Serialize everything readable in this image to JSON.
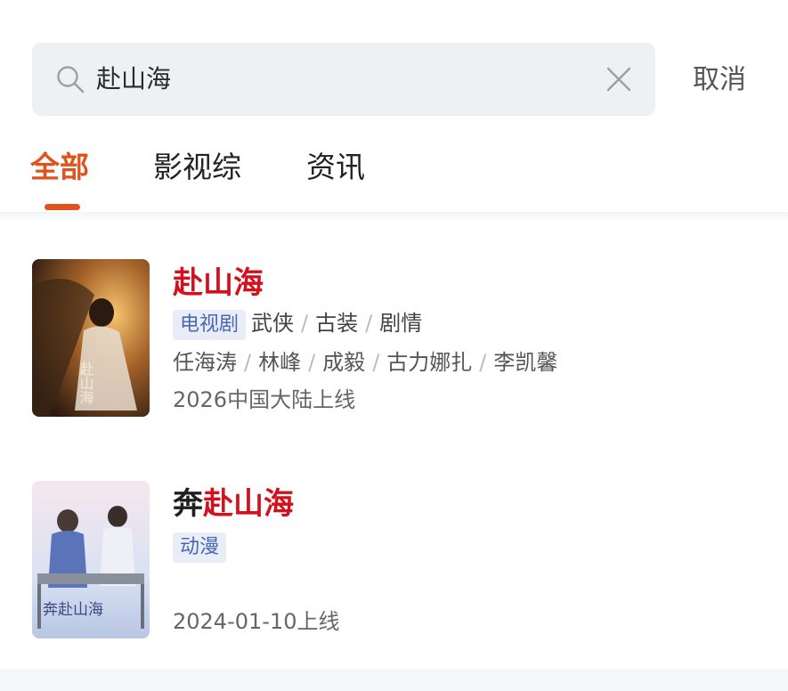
{
  "search": {
    "query": "赴山海",
    "cancel_label": "取消"
  },
  "tabs": [
    {
      "label": "全部",
      "active": true
    },
    {
      "label": "影视综",
      "active": false
    },
    {
      "label": "资讯",
      "active": false
    }
  ],
  "results": [
    {
      "title_prefix": "",
      "title_highlight": "赴山海",
      "category": "电视剧",
      "genres": [
        "武侠",
        "古装",
        "剧情"
      ],
      "cast": [
        "任海涛",
        "林峰",
        "成毅",
        "古力娜扎",
        "李凯馨"
      ],
      "release": "2026中国大陆上线",
      "poster_text": "赴山海"
    },
    {
      "title_prefix": "奔",
      "title_highlight": "赴山海",
      "category": "动漫",
      "release": "2024-01-10上线",
      "poster_text": "奔赴山海"
    }
  ],
  "colors": {
    "accent": "#e0531c",
    "highlight": "#d4101c",
    "badge_bg": "#e8edf8",
    "badge_text": "#4a67b5"
  }
}
